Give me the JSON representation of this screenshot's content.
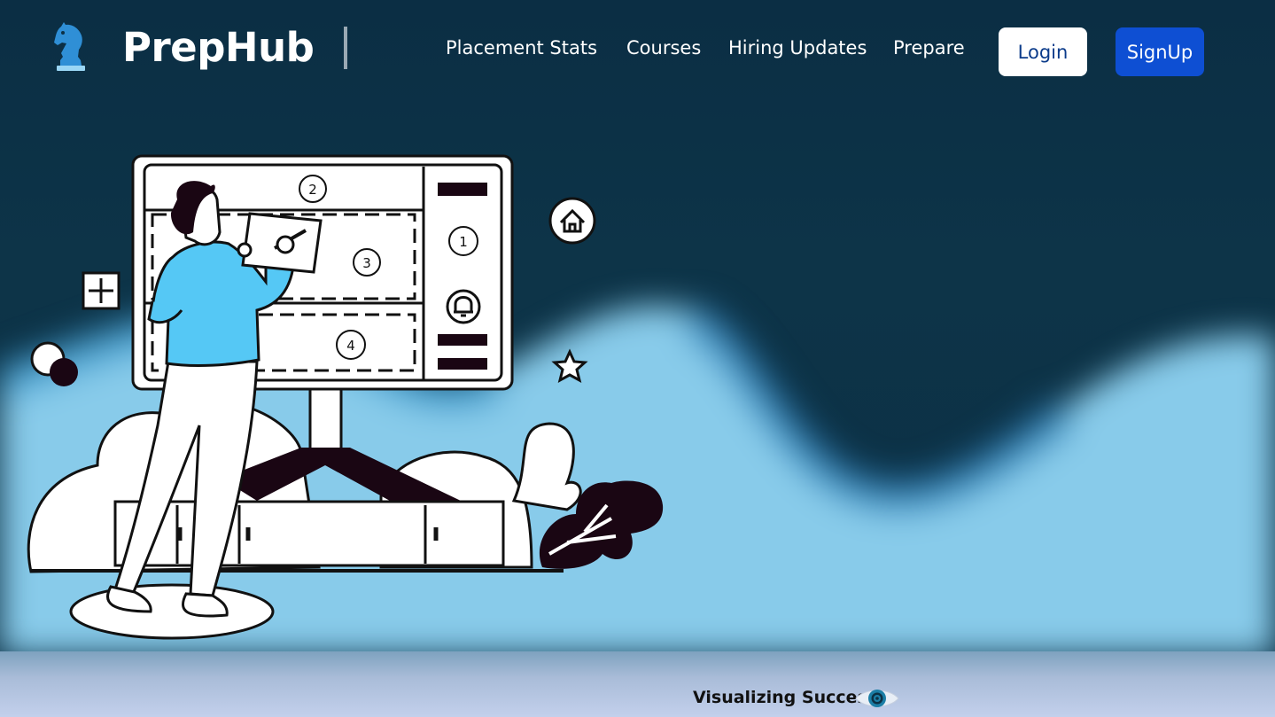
{
  "navbar": {
    "brand": "PrepHub",
    "links": [
      "Placement Stats",
      "Courses",
      "Hiring Updates",
      "Prepare"
    ],
    "login_label": "Login",
    "signup_label": "SignUp"
  },
  "illustration": {
    "panel_numbers": [
      "1",
      "2",
      "3",
      "4"
    ]
  },
  "footer": {
    "tagline": "Visualizing Success"
  },
  "icons": {
    "logo": "chess-knight-icon",
    "eye": "eye-icon",
    "home": "home-icon",
    "bell": "bell-icon",
    "star": "star-icon",
    "plus": "plus-icon"
  },
  "colors": {
    "hero_dark": "#0c3044",
    "hero_light": "#88cbea",
    "login_bg": "#ffffff",
    "signup_bg": "#0e4fd3",
    "shirt": "#55c8f5"
  }
}
